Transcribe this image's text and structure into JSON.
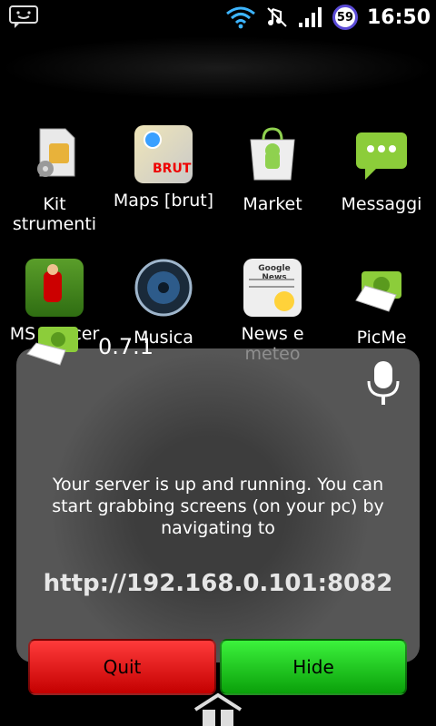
{
  "status_bar": {
    "time": "16:50",
    "battery_level": "59",
    "icons": [
      "messages-icon",
      "wifi-icon",
      "vibrate-icon",
      "signal-icon",
      "battery-icon"
    ]
  },
  "apps": [
    {
      "label": "Kit strumenti"
    },
    {
      "label": "Maps [brut]",
      "icon_text": "BRUT"
    },
    {
      "label": "Market"
    },
    {
      "label": "Messaggi"
    },
    {
      "label": "MS Soccer"
    },
    {
      "label": "Musica"
    },
    {
      "label": "News e meteo",
      "icon_text": "Google News"
    },
    {
      "label": "PicMe"
    }
  ],
  "dialog": {
    "version": "0.7.1",
    "message": "Your server is up and running. You can start grabbing screens (on your pc) by navigating to",
    "url": "http://192.168.0.101:8082",
    "quit_label": "Quit",
    "hide_label": "Hide"
  },
  "colors": {
    "quit": "#e00000",
    "hide": "#1bc81b",
    "badge_ring": "#5b4bd6"
  }
}
